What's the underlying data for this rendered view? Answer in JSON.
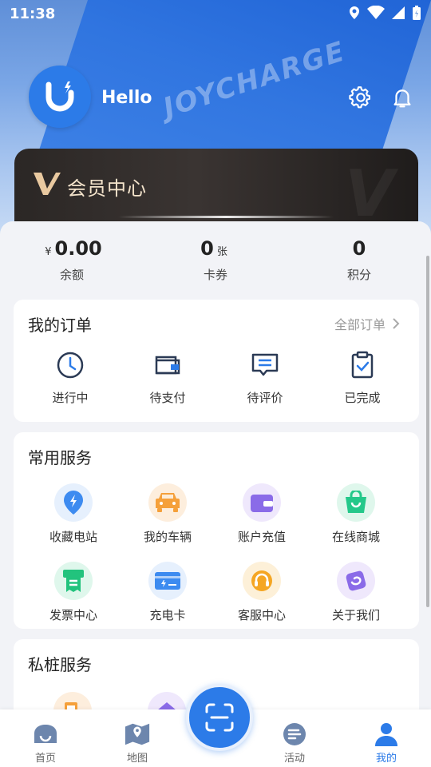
{
  "status_bar": {
    "time": "11:38"
  },
  "header": {
    "greeting": "Hello",
    "background_text": "JOYCHARGE"
  },
  "member": {
    "title": "会员中心"
  },
  "stats": {
    "balance": {
      "prefix": "¥",
      "value": "0.00",
      "label": "余额"
    },
    "coupons": {
      "value": "0",
      "unit": "张",
      "label": "卡券"
    },
    "points": {
      "value": "0",
      "label": "积分"
    }
  },
  "orders": {
    "title": "我的订单",
    "link": "全部订单",
    "items": [
      {
        "label": "进行中",
        "icon": "clock-icon"
      },
      {
        "label": "待支付",
        "icon": "wallet-icon"
      },
      {
        "label": "待评价",
        "icon": "comment-icon"
      },
      {
        "label": "已完成",
        "icon": "clipboard-check-icon"
      }
    ]
  },
  "services": {
    "title": "常用服务",
    "items": [
      {
        "label": "收藏电站",
        "icon": "location-bolt-icon",
        "color": "#3d8bf0"
      },
      {
        "label": "我的车辆",
        "icon": "car-icon",
        "color": "#f5a03a"
      },
      {
        "label": "账户充值",
        "icon": "wallet-icon",
        "color": "#8a6be8"
      },
      {
        "label": "在线商城",
        "icon": "shopping-bag-icon",
        "color": "#24c88a"
      },
      {
        "label": "发票中心",
        "icon": "invoice-icon",
        "color": "#22c37d"
      },
      {
        "label": "充电卡",
        "icon": "charge-card-icon",
        "color": "#3d8bf0"
      },
      {
        "label": "客服中心",
        "icon": "headset-icon",
        "color": "#f5a623"
      },
      {
        "label": "关于我们",
        "icon": "about-icon",
        "color": "#8a6be8"
      }
    ]
  },
  "private": {
    "title": "私桩服务"
  },
  "tabbar": {
    "items": [
      {
        "label": "首页",
        "icon": "home-icon"
      },
      {
        "label": "地图",
        "icon": "map-icon"
      },
      {
        "label": "活动",
        "icon": "activity-icon"
      },
      {
        "label": "我的",
        "icon": "user-icon"
      }
    ],
    "active_color": "#2c7be8"
  }
}
